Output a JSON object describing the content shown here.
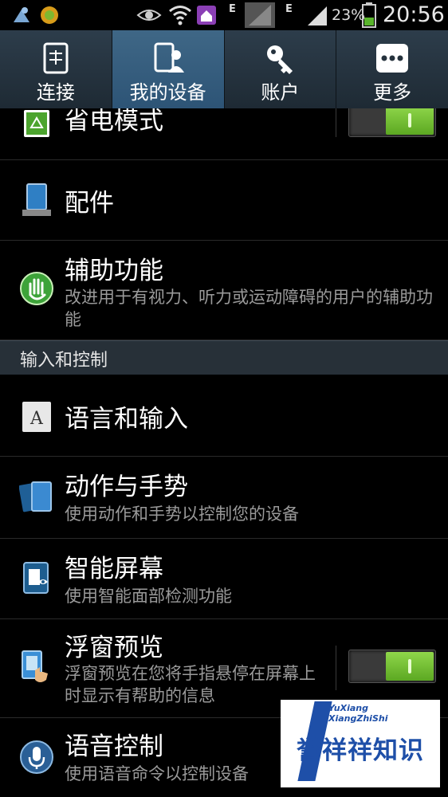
{
  "status_bar": {
    "net1": "E",
    "net2": "E",
    "battery_pct": "23%",
    "clock": "20:56",
    "icons": [
      "notification-icon",
      "app-icon",
      "eye-icon",
      "wifi-icon",
      "home-icon",
      "signal-icon",
      "signal-icon",
      "battery-icon"
    ]
  },
  "tabs": [
    {
      "label": "连接",
      "icon": "connect-icon",
      "active": false
    },
    {
      "label": "我的设备",
      "icon": "my-device-icon",
      "active": true
    },
    {
      "label": "账户",
      "icon": "key-icon",
      "active": false
    },
    {
      "label": "更多",
      "icon": "more-icon",
      "active": false
    }
  ],
  "settings": {
    "power_saving": {
      "title": "省电模式",
      "toggle_on": true,
      "icon": "recycle-icon"
    },
    "accessory": {
      "title": "配件",
      "icon": "device-dock-icon"
    },
    "accessibility": {
      "title": "辅助功能",
      "subtitle": "改进用于有视力、听力或运动障碍的用户的辅助功能",
      "icon": "hand-icon"
    },
    "section_input": "输入和控制",
    "language": {
      "title": "语言和输入",
      "icon": "keyboard-a-icon"
    },
    "motion": {
      "title": "动作与手势",
      "subtitle": "使用动作和手势以控制您的设备",
      "icon": "motion-icon"
    },
    "smart_screen": {
      "title": "智能屏幕",
      "subtitle": "使用智能面部检测功能",
      "icon": "smart-screen-icon"
    },
    "air_view": {
      "title": "浮窗预览",
      "subtitle": "浮窗预览在您将手指悬停在屏幕上时显示有帮助的信息",
      "toggle_on": true,
      "icon": "air-view-icon"
    },
    "voice_control": {
      "title": "语音控制",
      "subtitle": "使用语音命令以控制设备",
      "icon": "mic-icon"
    }
  },
  "watermark": {
    "line1": "YuXiang",
    "line2": "XiangZhiShi",
    "main": "誉祥祥知识"
  },
  "colors": {
    "accent": "#3a6689",
    "toggle_on": "#6cbf2e",
    "section_bg": "#273038"
  }
}
